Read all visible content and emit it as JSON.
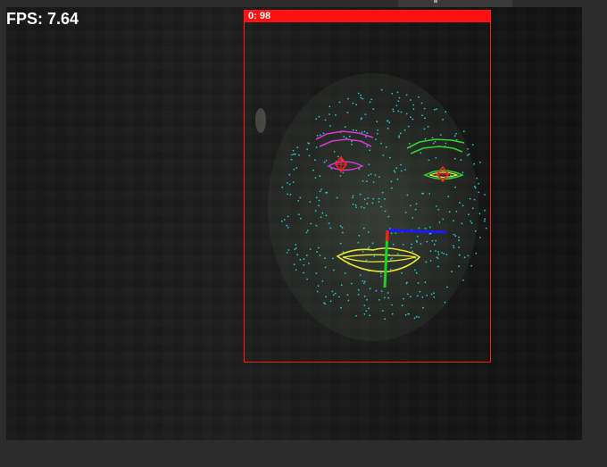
{
  "overlay": {
    "fps_text": "FPS: 7.64",
    "face_label": "0: 98"
  },
  "colors": {
    "box": "#ff1a1a",
    "mesh_points": "#26c6d0",
    "left_brow": "#d23ad2",
    "right_brow": "#2ed62e",
    "left_eye": "#d23ad2",
    "right_eye": "#f0e040",
    "iris": "#ff2020",
    "lips": "#e6e633",
    "axis_x": "#1a1aff",
    "axis_y": "#1fd11f",
    "axis_z": "#ff1a1a"
  }
}
